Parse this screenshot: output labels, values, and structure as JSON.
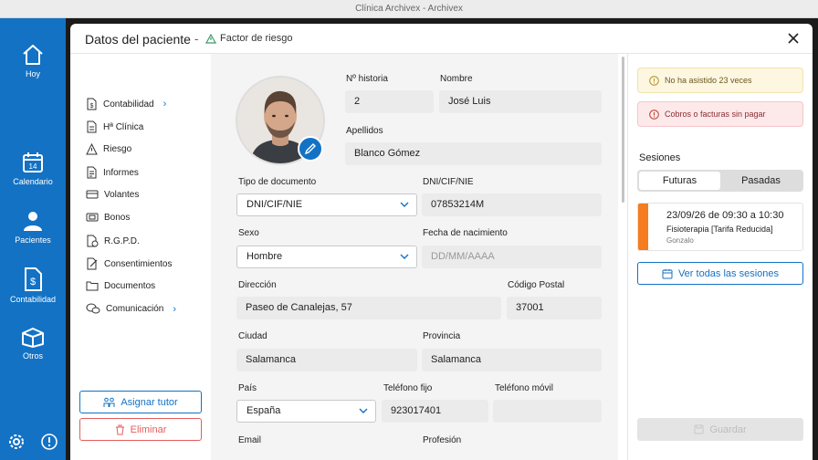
{
  "window": {
    "title": "Clínica Archivex - Archivex"
  },
  "nav": {
    "home": "Hoy",
    "calendar": "Calendario",
    "calendar_day": "14",
    "patients": "Pacientes",
    "accounting": "Contabilidad",
    "others": "Otros"
  },
  "modal": {
    "title": "Datos del paciente",
    "separator": "-",
    "risk_label": "Factor de riesgo"
  },
  "menu": {
    "items": [
      {
        "label": "Contabilidad",
        "icon": "dollar-doc-icon",
        "has_arrow": true
      },
      {
        "label": "Hª Clínica",
        "icon": "document-icon",
        "has_arrow": false
      },
      {
        "label": "Riesgo",
        "icon": "warning-icon",
        "has_arrow": false
      },
      {
        "label": "Informes",
        "icon": "report-icon",
        "has_arrow": false
      },
      {
        "label": "Volantes",
        "icon": "card-icon",
        "has_arrow": false
      },
      {
        "label": "Bonos",
        "icon": "ticket-icon",
        "has_arrow": false
      },
      {
        "label": "R.G.P.D.",
        "icon": "privacy-doc-icon",
        "has_arrow": false
      },
      {
        "label": "Consentimientos",
        "icon": "sign-icon",
        "has_arrow": false
      },
      {
        "label": "Documentos",
        "icon": "folder-icon",
        "has_arrow": false
      },
      {
        "label": "Comunicación",
        "icon": "chat-icon",
        "has_arrow": true
      }
    ],
    "arrow": "›",
    "assign_tutor": "Asignar tutor",
    "delete": "Eliminar"
  },
  "form": {
    "historia_label": "Nº historia",
    "historia_value": "2",
    "nombre_label": "Nombre",
    "nombre_value": "José Luis",
    "apellidos_label": "Apellidos",
    "apellidos_value": "Blanco Gómez",
    "tipo_doc_label": "Tipo de documento",
    "tipo_doc_value": "DNI/CIF/NIE",
    "dni_label": "DNI/CIF/NIE",
    "dni_value": "07853214M",
    "sexo_label": "Sexo",
    "sexo_value": "Hombre",
    "nacimiento_label": "Fecha de nacimiento",
    "nacimiento_placeholder": "DD/MM/AAAA",
    "direccion_label": "Dirección",
    "direccion_value": "Paseo de Canalejas, 57",
    "cp_label": "Código Postal",
    "cp_value": "37001",
    "ciudad_label": "Ciudad",
    "ciudad_value": "Salamanca",
    "provincia_label": "Provincia",
    "provincia_value": "Salamanca",
    "pais_label": "País",
    "pais_value": "España",
    "tel_fijo_label": "Teléfono fijo",
    "tel_fijo_value": "923017401",
    "tel_movil_label": "Teléfono móvil",
    "tel_movil_value": "",
    "email_label": "Email",
    "profesion_label": "Profesión"
  },
  "right": {
    "alert_warning": "No ha asistido 23 veces",
    "alert_error": "Cobros o facturas sin pagar",
    "sessions_title": "Sesiones",
    "tab_future": "Futuras",
    "tab_past": "Pasadas",
    "session": {
      "date": "23/09/26 de 09:30 a 10:30",
      "type": "Fisioterapia [Tarifa Reducida]",
      "who": "Gonzalo"
    },
    "view_all": "Ver todas las sesiones",
    "save": "Guardar"
  },
  "colors": {
    "primary": "#1372c4",
    "danger": "#e45c5c",
    "session_accent": "#f57c1f",
    "warning_bg": "#fdf6e0",
    "error_bg": "#fde9ea"
  }
}
